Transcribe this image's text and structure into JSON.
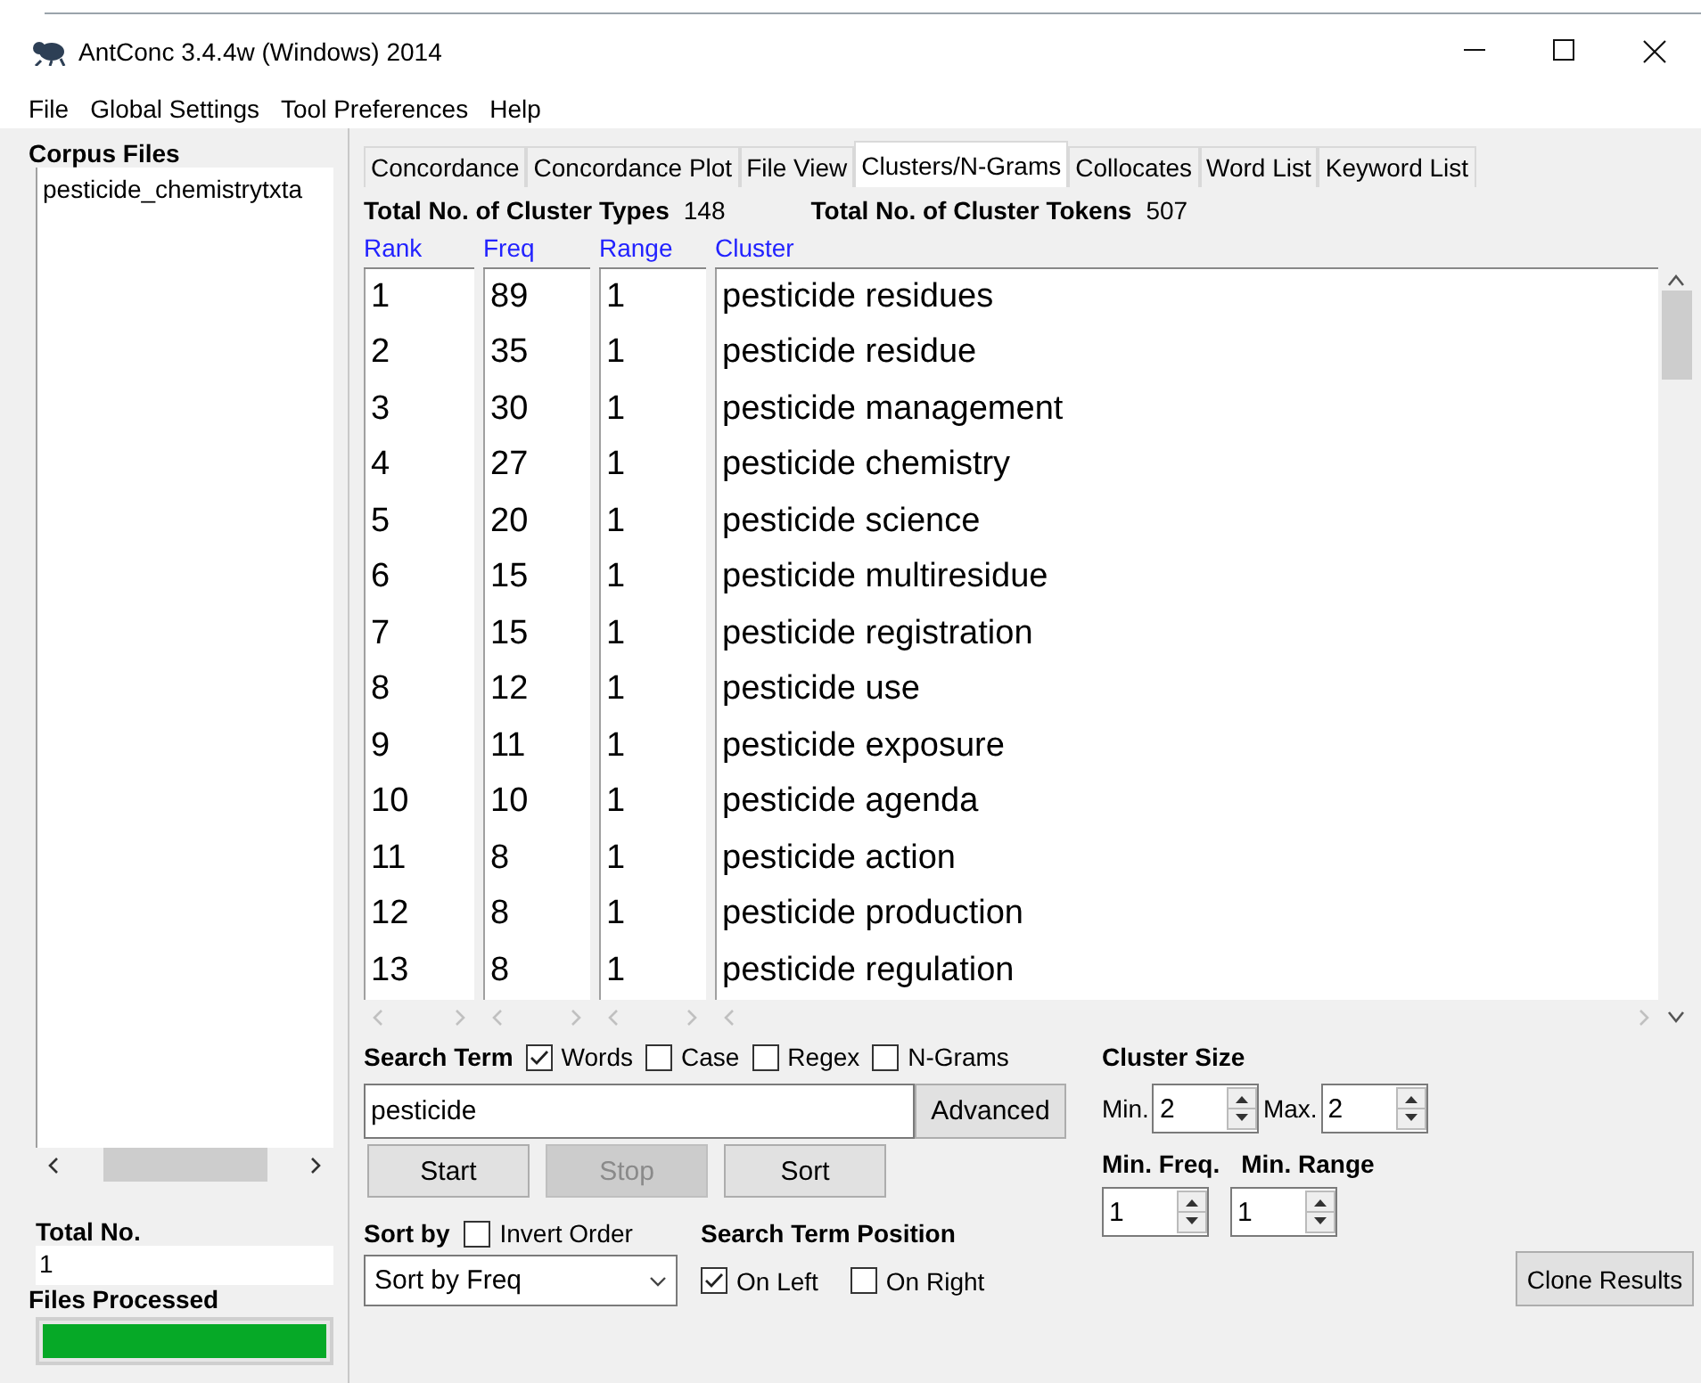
{
  "window": {
    "title": "AntConc 3.4.4w (Windows) 2014"
  },
  "menu": [
    "File",
    "Global Settings",
    "Tool Preferences",
    "Help"
  ],
  "corpus_files": {
    "title": "Corpus Files",
    "files": [
      "pesticide_chemistrytxta"
    ]
  },
  "total_no": {
    "label": "Total No.",
    "value": "1"
  },
  "files_processed": {
    "label": "Files Processed",
    "level": 1
  },
  "tabs": [
    {
      "label": "Concordance",
      "selected": false
    },
    {
      "label": "Concordance Plot",
      "selected": false
    },
    {
      "label": "File View",
      "selected": false
    },
    {
      "label": "Clusters/N-Grams",
      "selected": true
    },
    {
      "label": "Collocates",
      "selected": false
    },
    {
      "label": "Word List",
      "selected": false
    },
    {
      "label": "Keyword List",
      "selected": false
    }
  ],
  "summary": [
    {
      "label": "Total No. of Cluster Types",
      "value": "148"
    },
    {
      "label": "Total No. of Cluster Tokens",
      "value": "507"
    }
  ],
  "table": {
    "columns": [
      "Rank",
      "Freq",
      "Range",
      "Cluster"
    ],
    "rows": [
      [
        "1",
        "89",
        "1",
        "pesticide residues"
      ],
      [
        "2",
        "35",
        "1",
        "pesticide residue"
      ],
      [
        "3",
        "30",
        "1",
        "pesticide management"
      ],
      [
        "4",
        "27",
        "1",
        "pesticide chemistry"
      ],
      [
        "5",
        "20",
        "1",
        "pesticide science"
      ],
      [
        "6",
        "15",
        "1",
        "pesticide multiresidue"
      ],
      [
        "7",
        "15",
        "1",
        "pesticide registration"
      ],
      [
        "8",
        "12",
        "1",
        "pesticide use"
      ],
      [
        "9",
        "11",
        "1",
        "pesticide exposure"
      ],
      [
        "10",
        "10",
        "1",
        "pesticide agenda"
      ],
      [
        "11",
        "8",
        "1",
        "pesticide action"
      ],
      [
        "12",
        "8",
        "1",
        "pesticide production"
      ],
      [
        "13",
        "8",
        "1",
        "pesticide regulation"
      ]
    ]
  },
  "search_term": {
    "label": "Search Term",
    "options": [
      {
        "label": "Words",
        "checked": true
      },
      {
        "label": "Case",
        "checked": false
      },
      {
        "label": "Regex",
        "checked": false
      },
      {
        "label": "N-Grams",
        "checked": false
      }
    ],
    "value": "pesticide",
    "advanced_button": "Advanced"
  },
  "buttons": [
    {
      "label": "Start",
      "disabled": false
    },
    {
      "label": "Stop",
      "disabled": true
    },
    {
      "label": "Sort",
      "disabled": false
    }
  ],
  "sort_by": {
    "label": "Sort by",
    "invert": {
      "label": "Invert Order",
      "checked": false
    },
    "value": "Sort by Freq"
  },
  "position": {
    "label": "Search Term Position",
    "options": [
      {
        "label": "On Left",
        "checked": true
      },
      {
        "label": "On Right",
        "checked": false
      }
    ]
  },
  "cluster_size": {
    "label": "Cluster Size",
    "min_label": "Min.",
    "min": "2",
    "max_label": "Max.",
    "max": "2"
  },
  "min_freq": {
    "label": "Min. Freq.",
    "value": "1"
  },
  "min_range": {
    "label": "Min. Range",
    "value": "1"
  },
  "clone_button": "Clone Results"
}
